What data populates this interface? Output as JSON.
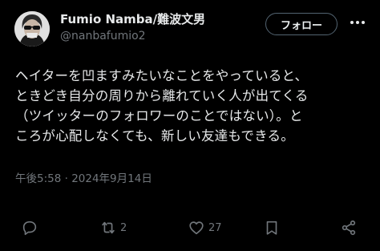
{
  "author": {
    "display_name": "Fumio Namba/難波文男",
    "handle": "@nanbafumio2"
  },
  "follow_label": "フォロー",
  "tweet": {
    "lines": [
      "ヘイターを凹ますみたいなことをやっていると、",
      "ときどき自分の周りから離れていく人が出てくる",
      "（ツイッターのフォロワーのことではない）。と",
      "ころが心配しなくても、新しい友達もできる。"
    ],
    "timestamp": "午後5:58 · 2024年9月14日"
  },
  "actions": {
    "reply_icon": "reply-icon",
    "retweet_icon": "retweet-icon",
    "retweet_count": "2",
    "like_icon": "like-icon",
    "like_count": "27",
    "bookmark_icon": "bookmark-icon",
    "share_icon": "share-icon"
  },
  "colors": {
    "background": "#000000",
    "text": "#e7e9ea",
    "secondary": "#71767b",
    "border": "#536471"
  }
}
